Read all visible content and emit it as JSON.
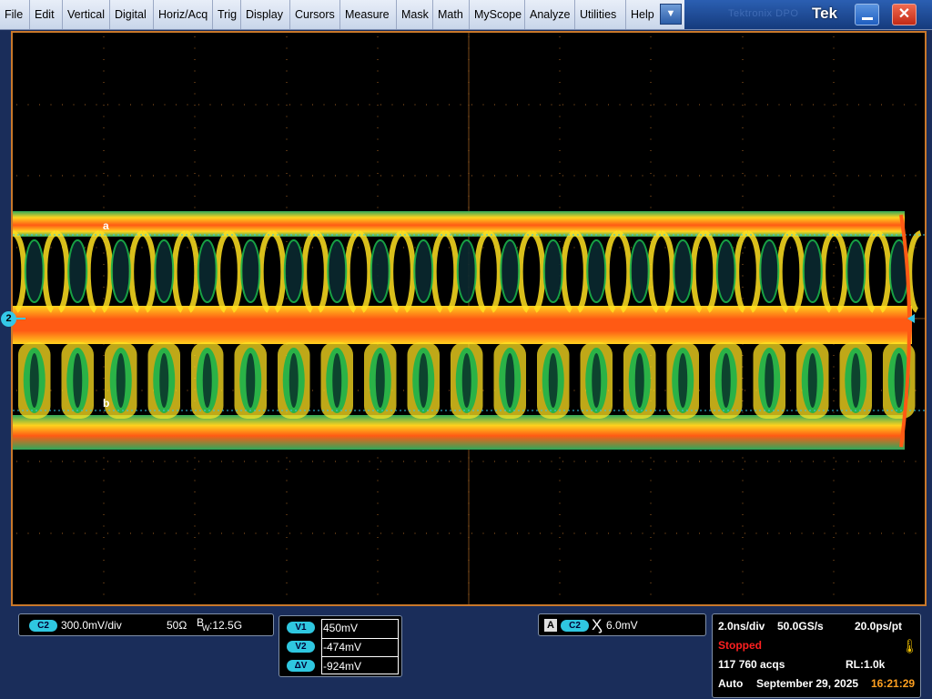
{
  "menu": {
    "items": [
      "File",
      "Edit",
      "Vertical",
      "Digital",
      "Horiz/Acq",
      "Trig",
      "Display",
      "Cursors",
      "Measure",
      "Mask",
      "Math",
      "MyScope",
      "Analyze",
      "Utilities",
      "Help"
    ],
    "dropdown_icon": "chevron-down-icon"
  },
  "titlebar": {
    "ghost_title": "Tektronix DPO",
    "logo": "Tek",
    "minimize_icon": "minimize-icon",
    "close_icon": "close-icon"
  },
  "display": {
    "channel_marker": "2",
    "cursor_labels": {
      "a": "a",
      "b": "b"
    },
    "colors": {
      "grid": "#c8782a",
      "ch2": "#35c8e8",
      "trace_hot": "#ff5a14",
      "trace_mid": "#ffe020",
      "trace_cool": "#1ab24c"
    }
  },
  "channel_panel": {
    "channel": "C2",
    "scale": "300.0mV/div",
    "impedance": "50Ω",
    "bw_label_b": "B",
    "bw_label_w": "W",
    "bw_value": ":12.5G"
  },
  "cursor_panel": {
    "rows": [
      {
        "label": "V1",
        "value": "450mV"
      },
      {
        "label": "V2",
        "value": "-474mV"
      },
      {
        "label": "ΔV",
        "value": "-924mV"
      }
    ]
  },
  "trigger_panel": {
    "mode": "A",
    "channel": "C2",
    "slope_icon": "trigger-edge-icon",
    "level": "6.0mV"
  },
  "acq_panel": {
    "time_div": "2.0ns/div",
    "sample_rate": "50.0GS/s",
    "resolution": "20.0ps/pt",
    "status": "Stopped",
    "acqs": "117 760 acqs",
    "record_length": "RL:1.0k",
    "mode": "Auto",
    "date": "September 29, 2025",
    "time": "16:21:29",
    "status_color": "#ff2020",
    "time_color": "#ffa020"
  }
}
